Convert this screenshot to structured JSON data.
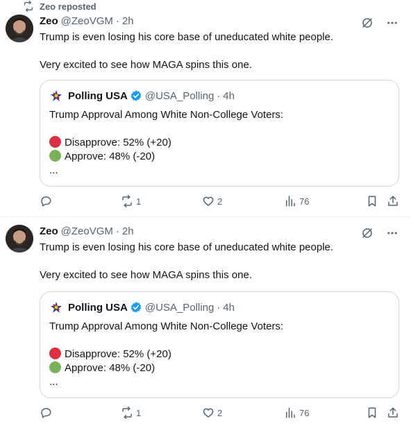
{
  "repost_label": "Zeo reposted",
  "tweets": [
    {
      "author_name": "Zeo",
      "author_handle": "@ZeoVGM",
      "separator": "·",
      "time": "2h",
      "text_line1": "Trump is even losing his core base of uneducated white people.",
      "text_line2": "Very excited to see how MAGA spins this one.",
      "quote": {
        "name": "Polling USA",
        "handle": "@USA_Polling",
        "separator": "·",
        "time": "4h",
        "line1": "Trump Approval Among White Non-College Voters:",
        "disapprove": "Disapprove: 52% (+20)",
        "approve": "Approve: 48% (-20)",
        "more": "..."
      },
      "retweets": "1",
      "likes": "2",
      "views": "76"
    },
    {
      "author_name": "Zeo",
      "author_handle": "@ZeoVGM",
      "separator": "·",
      "time": "2h",
      "text_line1": "Trump is even losing his core base of uneducated white people.",
      "text_line2": "Very excited to see how MAGA spins this one.",
      "quote": {
        "name": "Polling USA",
        "handle": "@USA_Polling",
        "separator": "·",
        "time": "4h",
        "line1": "Trump Approval Among White Non-College Voters:",
        "disapprove": "Disapprove: 52% (+20)",
        "approve": "Approve: 48% (-20)",
        "more": "..."
      },
      "retweets": "1",
      "likes": "2",
      "views": "76"
    }
  ],
  "icons": {
    "repost": "repost-icon",
    "grok": "grok-icon",
    "more": "more-icon",
    "verified": "verified-badge-icon",
    "reply": "reply-icon",
    "retweet": "retweet-icon",
    "like": "like-icon",
    "views": "views-icon",
    "bookmark": "bookmark-icon",
    "share": "share-icon"
  },
  "colors": {
    "text": "#0f1419",
    "muted": "#536471",
    "border": "#cfd9de",
    "verified": "#1d9bf0",
    "disapprove_red": "#dd2e44",
    "approve_green": "#78b159"
  }
}
